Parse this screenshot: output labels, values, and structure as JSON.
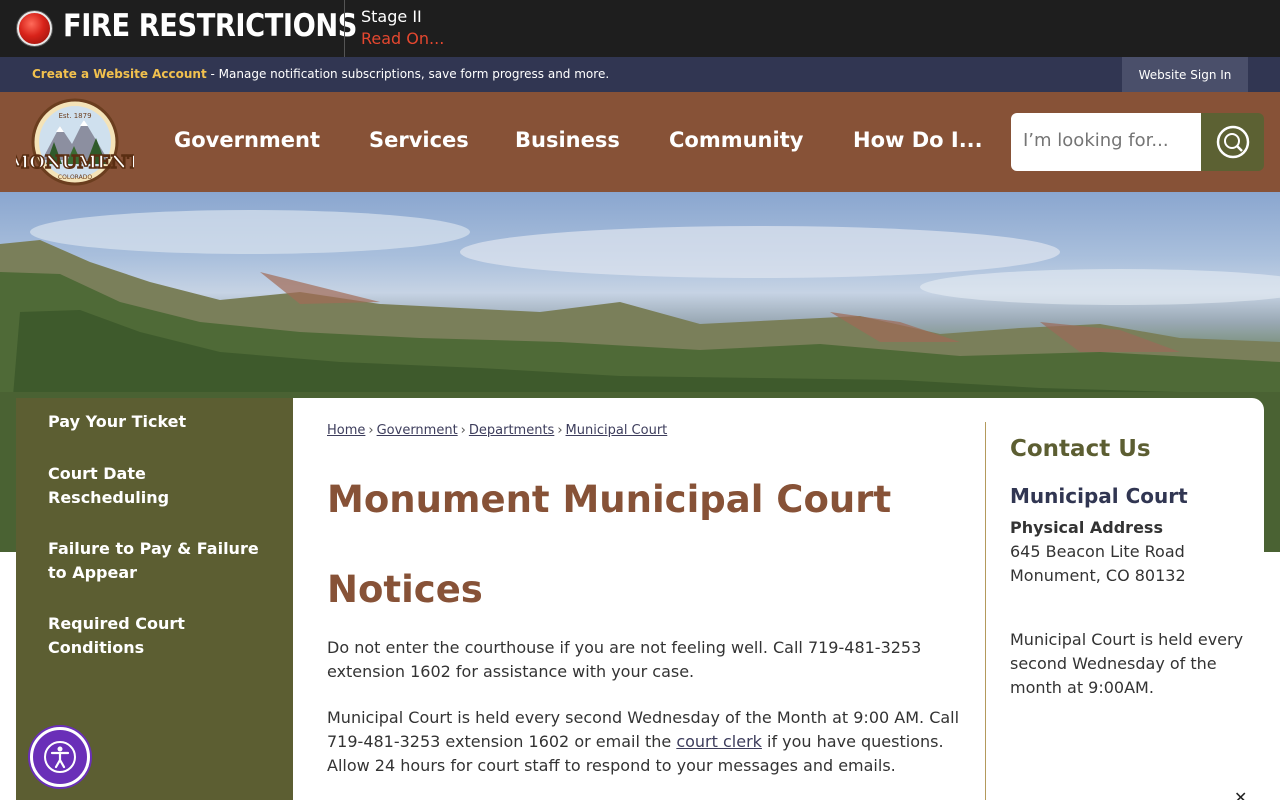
{
  "alert": {
    "title": "FIRE RESTRICTIONS",
    "stage": "Stage II",
    "read_on": "Read On..."
  },
  "account_bar": {
    "create_link": "Create a Website Account",
    "description": " - Manage notification subscriptions, save form progress and more.",
    "sign_in": "Website Sign In"
  },
  "header": {
    "logo_text": "MONUMENT",
    "logo_est": "Est. 1879",
    "logo_state": "COLORADO",
    "nav": [
      "Government",
      "Services",
      "Business",
      "Community",
      "How Do I..."
    ],
    "search_placeholder": "I’m looking for..."
  },
  "sidebar": {
    "items": [
      "Pay Your Ticket",
      "Court Date Rescheduling",
      "Failure to Pay & Failure to Appear",
      "Required Court Conditions"
    ]
  },
  "breadcrumb": [
    "Home",
    "Government",
    "Departments",
    "Municipal Court"
  ],
  "main": {
    "title": "Monument Municipal Court",
    "notices_heading": "Notices",
    "para1": "Do not enter the courthouse if you are not feeling well. Call 719-481-3253 extension 1602 for assistance with your case.",
    "para2_before": "Municipal Court is held every second Wednesday of the Month at 9:00 AM.  Call 719-481-3253 extension 1602 or email the ",
    "para2_link": "court clerk",
    "para2_after": " if you have questions. Allow 24 hours for court staff to respond to your messages and emails."
  },
  "contact": {
    "title": "Contact Us",
    "dept": "Municipal Court",
    "address_label": "Physical Address",
    "address_line1": "645 Beacon Lite Road",
    "address_line2": "Monument, CO 80132",
    "note": "Municipal Court is held every second Wednesday of the month at 9:00AM."
  },
  "colors": {
    "header_brown": "#875237",
    "olive": "#5c5e32",
    "navy": "#313652",
    "alert_red": "#e4472f"
  }
}
